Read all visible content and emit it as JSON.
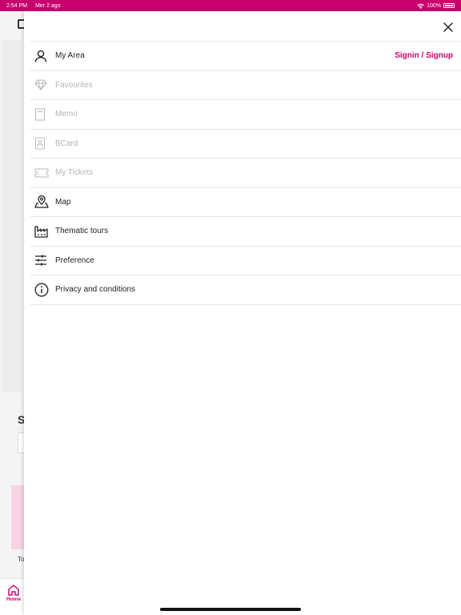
{
  "status_bar": {
    "time": "2:54 PM",
    "date": "Mer 2 ago",
    "battery": "100%",
    "color": "#c8006e"
  },
  "background": {
    "section_fragment": "S",
    "card_fragment": "To",
    "tab_home": "Home"
  },
  "drawer": {
    "close_icon": "close-icon",
    "items": [
      {
        "label": "My Area",
        "icon": "person-icon",
        "enabled": true,
        "action": "Signin / Signup"
      },
      {
        "label": "Favourites",
        "icon": "diamond-icon",
        "enabled": false
      },
      {
        "label": "Memo",
        "icon": "memo-icon",
        "enabled": false
      },
      {
        "label": "BCard",
        "icon": "business-card-icon",
        "enabled": false
      },
      {
        "label": "My Tickets",
        "icon": "ticket-icon",
        "enabled": false
      },
      {
        "label": "Map",
        "icon": "map-pin-icon",
        "enabled": true
      },
      {
        "label": "Thematic tours",
        "icon": "factory-icon",
        "enabled": true
      },
      {
        "label": "Preference",
        "icon": "sliders-icon",
        "enabled": true
      },
      {
        "label": "Privacy and conditions",
        "icon": "info-icon",
        "enabled": true
      }
    ]
  },
  "colors": {
    "accent": "#c8006e",
    "disabled_text": "#b4b4b4",
    "divider": "#e4e4e4"
  }
}
